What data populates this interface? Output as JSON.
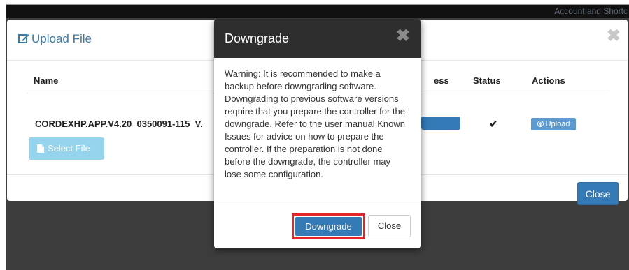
{
  "topbar": {
    "account_link": "Account and Shortc"
  },
  "upload_modal": {
    "title": "Upload File",
    "close_glyph": "✖",
    "columns": {
      "name": "Name",
      "progress": "ess",
      "status": "Status",
      "actions": "Actions"
    },
    "row": {
      "file_name": "CORDEXHP.APP.V4.20_0350091-115_V.",
      "progress_value": 100,
      "status_glyph": "✔",
      "upload_button": "Upload"
    },
    "select_file_button": "Select File",
    "close_button": "Close"
  },
  "downgrade_dialog": {
    "title": "Downgrade",
    "close_glyph": "✖",
    "message": "Warning: It is recommended to make a backup before downgrading software. Downgrading to previous software versions require that you prepare the controller for the downgrade. Refer to the user manual Known Issues for advice on how to prepare the controller. If the preparation is not done before the downgrade, the controller may lose some configuration.",
    "downgrade_button": "Downgrade",
    "close_button": "Close"
  },
  "colors": {
    "primary": "#337ab7",
    "title_link": "#3c7aa8",
    "select_file": "#95d4ec",
    "highlight": "#e0262b",
    "dialog_header": "#2e2e2e"
  },
  "icons": {
    "title": "edit-icon",
    "select_file": "file-icon",
    "upload": "arrow-up-circle-icon",
    "status": "check-icon"
  }
}
